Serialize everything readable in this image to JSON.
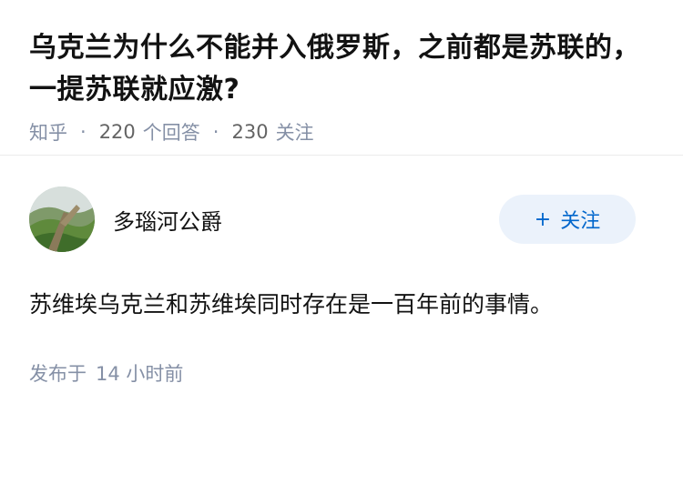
{
  "question": {
    "title": "乌克兰为什么不能并入俄罗斯，之前都是苏联的，一提苏联就应激?",
    "source": "知乎",
    "answers_count": "220",
    "answers_label": "个回答",
    "followers_count": "230",
    "followers_label": "关注"
  },
  "author": {
    "name": "多瑙河公爵",
    "avatar": "landscape-avatar",
    "follow_plus": "+",
    "follow_label": "关注"
  },
  "answer": {
    "text": "苏维埃乌克兰和苏维埃同时存在是一百年前的事情。"
  },
  "publish": {
    "label": "发布于",
    "time": "14 小时前"
  },
  "colors": {
    "accent": "#0066cc",
    "button_bg": "#ebf2fb",
    "meta_gray": "#8590a6"
  }
}
